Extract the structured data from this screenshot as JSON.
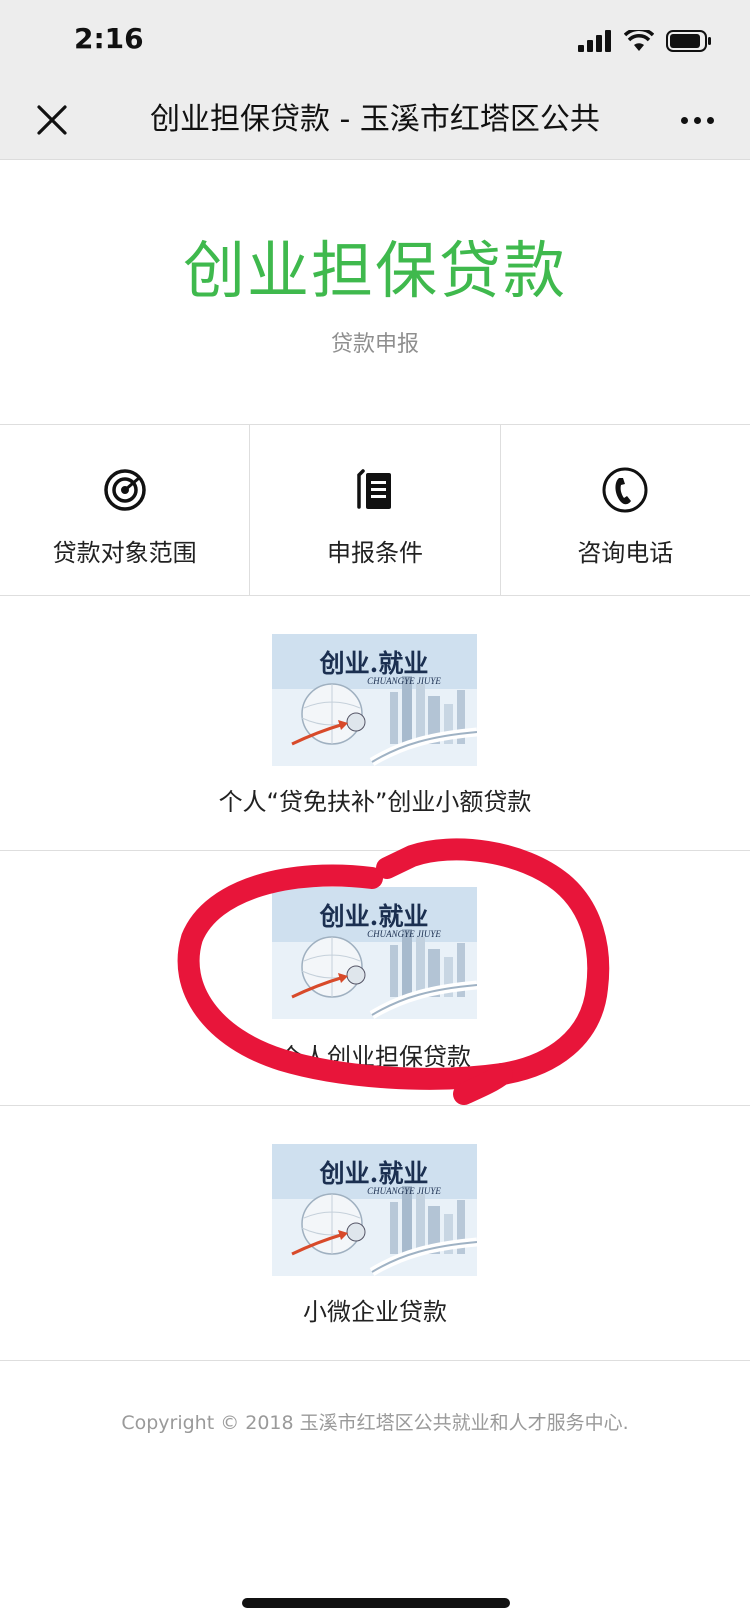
{
  "status_bar": {
    "time": "2:16"
  },
  "nav": {
    "title": "创业担保贷款 - 玉溪市红塔区公共",
    "close_icon": "close-icon",
    "more_icon": "more-icon"
  },
  "hero": {
    "title": "创业担保贷款",
    "subtitle": "贷款申报"
  },
  "quick_links": [
    {
      "label": "贷款对象范围",
      "icon": "target-icon"
    },
    {
      "label": "申报条件",
      "icon": "document-icon"
    },
    {
      "label": "咨询电话",
      "icon": "phone-icon"
    }
  ],
  "loans": [
    {
      "label": "个人“贷免扶补”创业小额贷款",
      "image_title": "创业.就业",
      "image_subtitle": "CHUANGYE JIUYE"
    },
    {
      "label": "个人创业担保贷款",
      "image_title": "创业.就业",
      "image_subtitle": "CHUANGYE JIUYE"
    },
    {
      "label": "小微企业贷款",
      "image_title": "创业.就业",
      "image_subtitle": "CHUANGYE JIUYE"
    }
  ],
  "footer": {
    "copyright": "Copyright © 2018 玉溪市红塔区公共就业和人才服务中心."
  },
  "colors": {
    "accent": "#3fb94d",
    "highlight": "#e8153a",
    "navbar": "#ededed"
  }
}
